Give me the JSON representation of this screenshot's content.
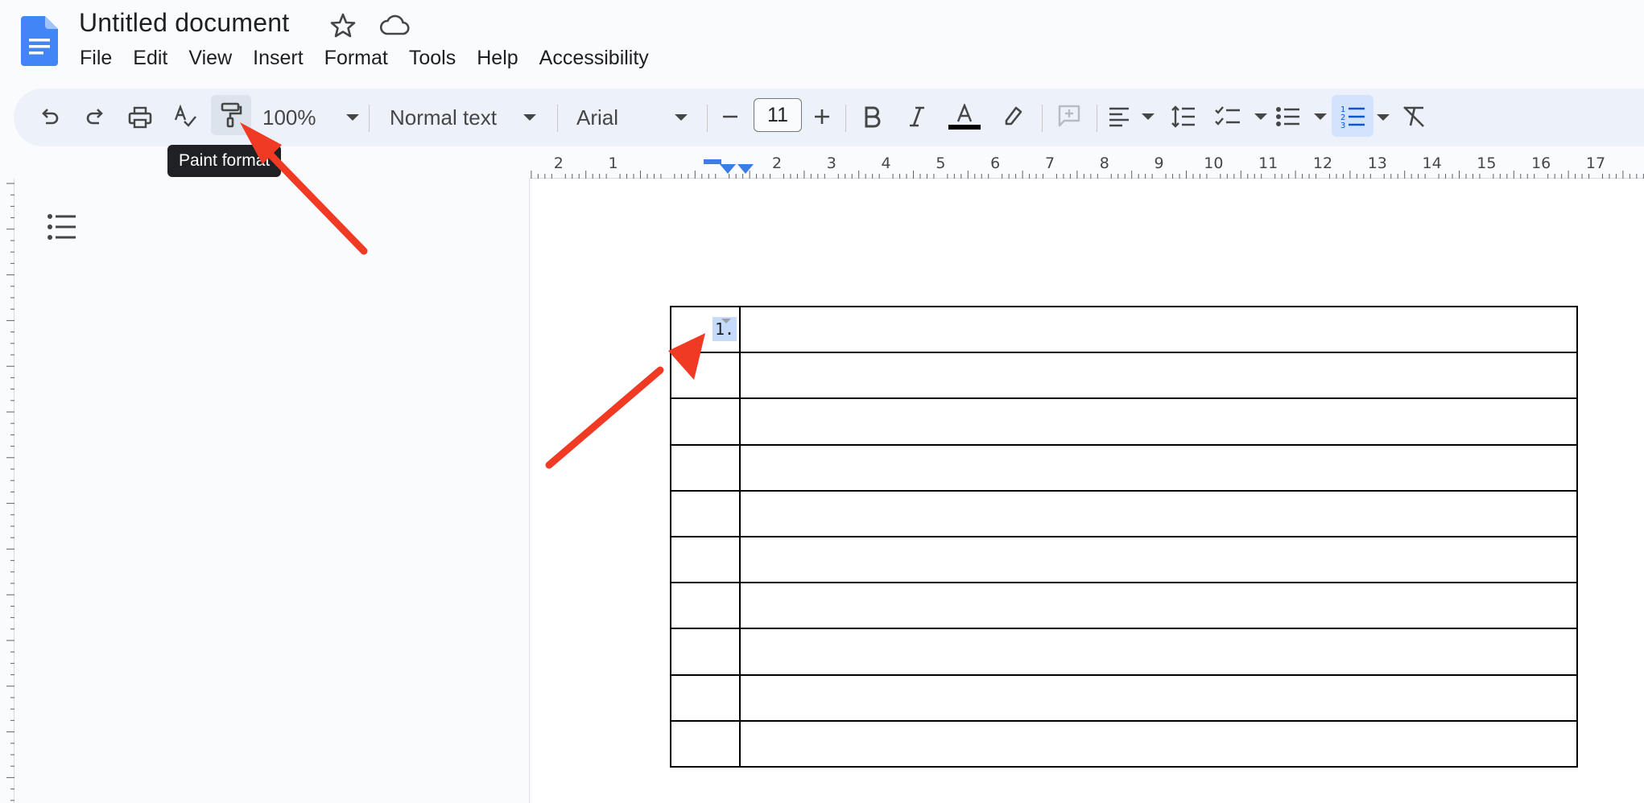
{
  "document": {
    "title": "Untitled document"
  },
  "menubar": {
    "items": [
      "File",
      "Edit",
      "View",
      "Insert",
      "Format",
      "Tools",
      "Help",
      "Accessibility"
    ]
  },
  "toolbar": {
    "zoom": "100%",
    "paragraph_style": "Normal text",
    "font": "Arial",
    "font_size": "11",
    "icons": [
      "undo-icon",
      "redo-icon",
      "print-icon",
      "spellcheck-icon",
      "paint-format-icon",
      "minus-icon",
      "plus-icon",
      "bold-icon",
      "italic-icon",
      "text-color-icon",
      "highlight-icon",
      "add-comment-icon",
      "align-left-icon",
      "line-spacing-icon",
      "checklist-icon",
      "bulleted-list-icon",
      "numbered-list-icon",
      "clear-formatting-icon"
    ],
    "text_color": "#000000",
    "active_tool_color": "#d3e3fd"
  },
  "tooltip": {
    "text": "Paint format"
  },
  "ruler": {
    "labels": [
      "2",
      "1",
      "2",
      "3",
      "4",
      "5",
      "6",
      "7",
      "8",
      "9",
      "10",
      "11",
      "12",
      "13",
      "14",
      "15",
      "16",
      "17"
    ]
  },
  "table": {
    "rows": 10,
    "first_cell_list_marker": "1."
  },
  "annotations": {
    "arrow_color": "#f03a24"
  }
}
